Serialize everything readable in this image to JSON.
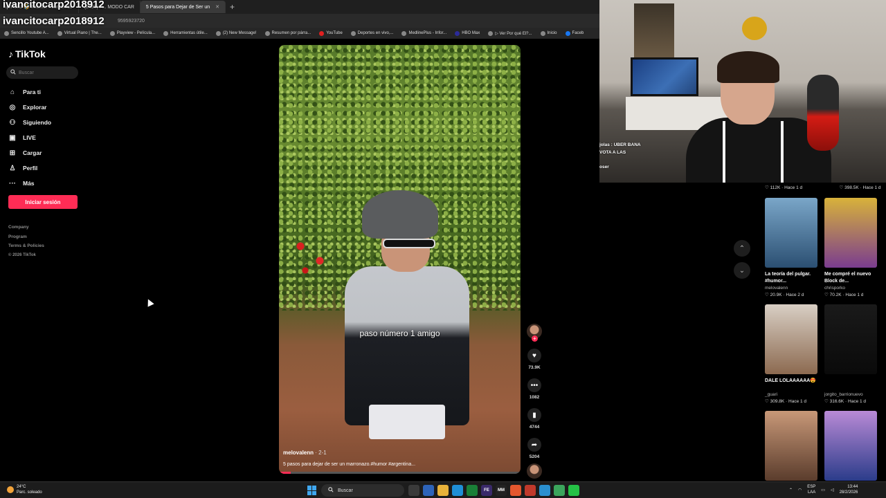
{
  "browser": {
    "tabs": [
      {
        "label": "ipn loko 🤣 #humor #contenido"
      },
      {
        "label": "(2430) P... MODO CAR"
      },
      {
        "label": "5 Pasos para Dejar de Ser un"
      }
    ],
    "new_tab": "+",
    "address_fragment": "9595923720",
    "bookmarks": [
      "Sencillo Youtube A...",
      "Virtual Piano | The...",
      "Playview - Película...",
      "Herramientas útile...",
      "(2) New Message!",
      "Resumen por párra...",
      "YouTube",
      "Deportes en vivo,...",
      "MedlinePlus - Infor...",
      "HBO Max",
      "▷ Ver Por qué El?...",
      "Inicio",
      "Faceb"
    ]
  },
  "stream_overlay": {
    "username": "ivancitocarp2018912"
  },
  "tiktok": {
    "logo": "TikTok",
    "search_placeholder": "Buscar",
    "nav": [
      {
        "label": "Para ti",
        "icon": "home-icon"
      },
      {
        "label": "Explorar",
        "icon": "compass-icon"
      },
      {
        "label": "Siguiendo",
        "icon": "following-icon"
      },
      {
        "label": "LIVE",
        "icon": "live-icon"
      },
      {
        "label": "Cargar",
        "icon": "upload-icon"
      },
      {
        "label": "Perfil",
        "icon": "profile-icon"
      },
      {
        "label": "Más",
        "icon": "more-icon"
      }
    ],
    "login_button": "Iniciar sesión",
    "footer": [
      "Company",
      "Program",
      "Terms & Policies"
    ],
    "copyright": "© 2026 TikTok"
  },
  "video": {
    "caption_overlay": "paso número 1 amigo",
    "author": "melovalenn",
    "date": "· 2-1",
    "description": "5 pasos para dejar de ser un marronazo.#humor #argentina...",
    "progress": 0.05,
    "actions": [
      {
        "name": "like",
        "icon": "heart-icon",
        "count": "73.9K"
      },
      {
        "name": "comment",
        "icon": "comment-icon",
        "count": "1082"
      },
      {
        "name": "save",
        "icon": "bookmark-icon",
        "count": "4744"
      },
      {
        "name": "share",
        "icon": "share-icon",
        "count": "5204"
      }
    ]
  },
  "webcam": {
    "chat": [
      "jolas : UBER BANA",
      "VOTA A LAS",
      "oser"
    ]
  },
  "related": {
    "top_row_stats": [
      "♡ 112K · Hace 1 d",
      "♡ 398.5K · Hace 1 d"
    ],
    "cards": [
      {
        "title": "La teoría del pulgar. #humor...",
        "author": "melovalenn",
        "stats": "♡ 20.9K · Hace 2 d",
        "color1": "#7aa6c8",
        "color2": "#2b4f72"
      },
      {
        "title": "Me compré el nuevo Block de...",
        "author": "chrisporko",
        "stats": "♡ 70.2K · Hace 1 d",
        "color1": "#d8b23a",
        "color2": "#7a3c8f"
      },
      {
        "title": "DALE LOLAAAAAA😍",
        "author": "_guari",
        "stats": "♡ 309.8K · Hace 1 d",
        "color1": "#d8cfc4",
        "color2": "#8c6a50"
      },
      {
        "title": "",
        "author": "jorgito_barrionuevo",
        "stats": "♡ 316.6K · Hace 1 d",
        "color1": "#1a1a1a",
        "color2": "#0a0a0a"
      },
      {
        "title": "",
        "author": "",
        "stats": "",
        "color1": "#c89878",
        "color2": "#5a3c2c"
      },
      {
        "title": "",
        "author": "",
        "stats": "",
        "color1": "#b98ad6",
        "color2": "#2b3c8a"
      }
    ]
  },
  "taskbar": {
    "weather_temp": "24°C",
    "weather_desc": "Parc. soleado",
    "search": "Buscar",
    "lang": "ESP",
    "lang2": "LAA",
    "time": "13:44",
    "date": "28/2/2026",
    "apps": [
      {
        "label": "",
        "color": "#3a3a3a"
      },
      {
        "label": "",
        "color": "#2d63b8"
      },
      {
        "label": "",
        "color": "#e8b23a"
      },
      {
        "label": "",
        "color": "#1f8fd6"
      },
      {
        "label": "",
        "color": "#1a7f37"
      },
      {
        "label": "FE",
        "color": "#3a2a6a"
      },
      {
        "label": "MM",
        "color": "#222"
      },
      {
        "label": "",
        "color": "#e4572e"
      },
      {
        "label": "",
        "color": "#c0392b"
      },
      {
        "label": "",
        "color": "#2a8fcf"
      },
      {
        "label": "",
        "color": "#3ba55c"
      },
      {
        "label": "",
        "color": "#25c246"
      }
    ]
  }
}
